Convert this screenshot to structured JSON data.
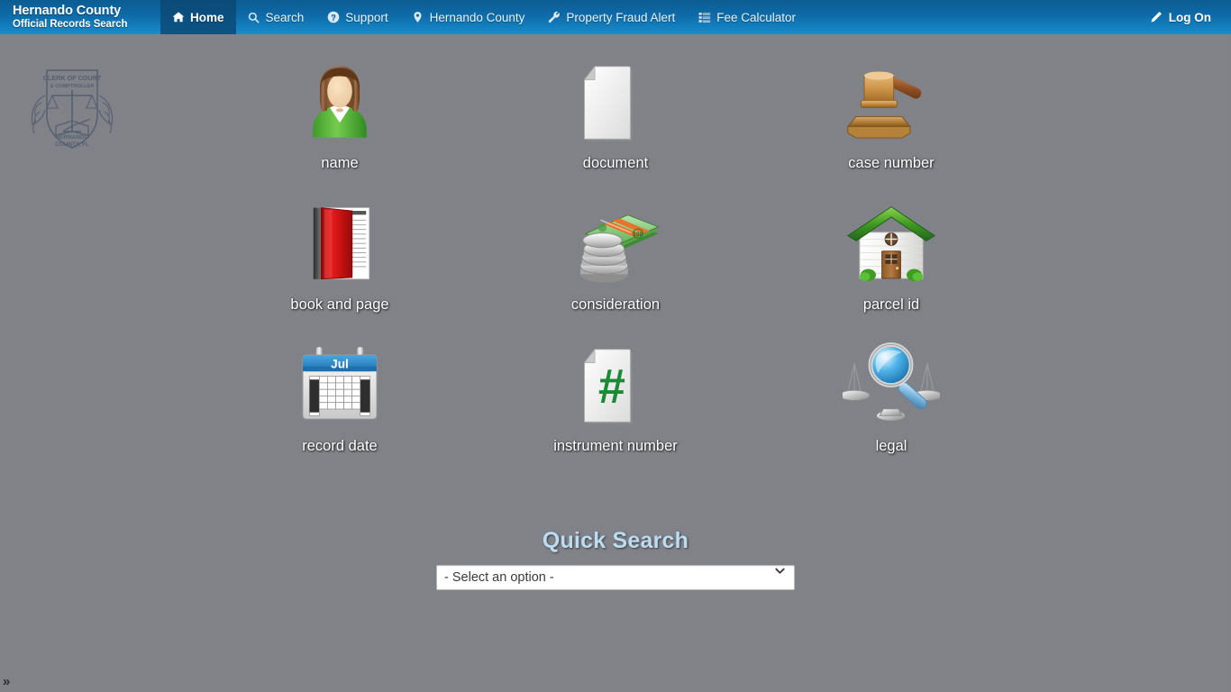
{
  "brand": {
    "line1": "Hernando County",
    "line2": "Official Records Search"
  },
  "nav": {
    "items": [
      {
        "label": "Home",
        "icon": "home-icon",
        "active": true
      },
      {
        "label": "Search",
        "icon": "search-icon",
        "active": false
      },
      {
        "label": "Support",
        "icon": "question-circle-icon",
        "active": false
      },
      {
        "label": "Hernando County",
        "icon": "map-marker-icon",
        "active": false
      },
      {
        "label": "Property Fraud Alert",
        "icon": "wrench-icon",
        "active": false
      },
      {
        "label": "Fee Calculator",
        "icon": "list-icon",
        "active": false
      }
    ],
    "logon": {
      "label": "Log On",
      "icon": "pencil-icon"
    }
  },
  "seal": {
    "icon": "county-seal-icon",
    "line1": "CLERK OF COURT",
    "line2": "& COMPTROLLER",
    "line3": "HERNANDO",
    "line4": "COUNTY, FL"
  },
  "search_tiles": [
    {
      "label": "name",
      "icon": "person-icon"
    },
    {
      "label": "document",
      "icon": "document-icon"
    },
    {
      "label": "case number",
      "icon": "gavel-icon"
    },
    {
      "label": "book and page",
      "icon": "red-book-icon"
    },
    {
      "label": "consideration",
      "icon": "money-coins-icon"
    },
    {
      "label": "parcel id",
      "icon": "house-icon"
    },
    {
      "label": "record date",
      "icon": "calendar-icon"
    },
    {
      "label": "instrument number",
      "icon": "hash-document-icon"
    },
    {
      "label": "legal",
      "icon": "scales-magnifier-icon"
    }
  ],
  "calendar": {
    "month": "Jul"
  },
  "quick_search": {
    "title": "Quick Search",
    "selected": "- Select an option -",
    "options": [
      "- Select an option -"
    ]
  },
  "expander": {
    "label": "»"
  },
  "colors": {
    "nav_top": "#0b5c92",
    "nav_bottom": "#1b90d0",
    "nav_active": "#0a4a78",
    "page_bg": "#808389",
    "quick_search_title": "#bcdcf2"
  }
}
